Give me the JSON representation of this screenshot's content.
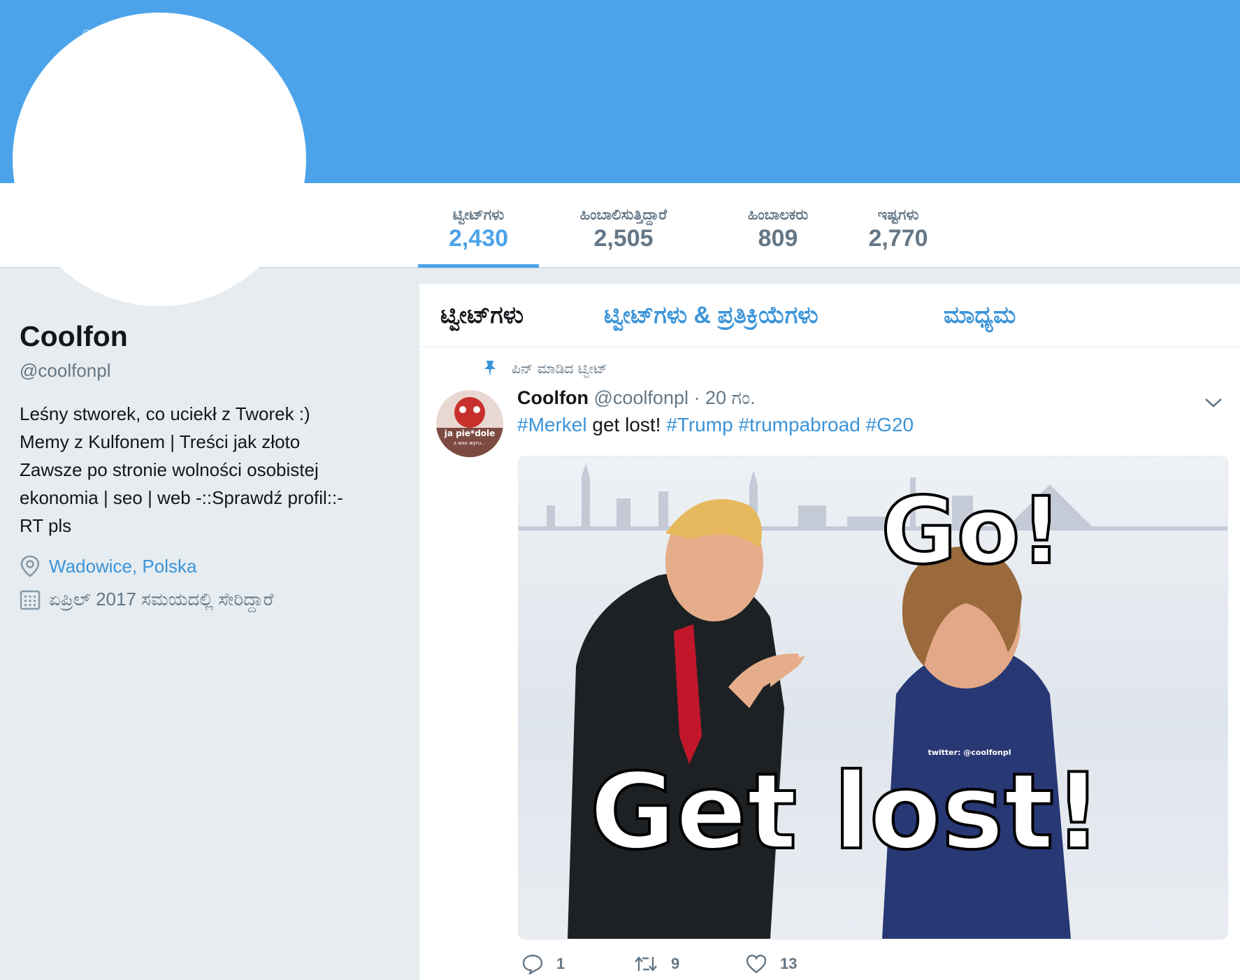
{
  "banner": {
    "partial_text": "on"
  },
  "stats": [
    {
      "label": "ಟ್ವೀಟ್‌ಗಳು",
      "value": "2,430",
      "active": true
    },
    {
      "label": "ಹಿಂಬಾಲಿಸುತ್ತಿದ್ದಾರೆ",
      "value": "2,505",
      "active": false
    },
    {
      "label": "ಹಿಂಬಾಲಕರು",
      "value": "809",
      "active": false
    },
    {
      "label": "ಇಷ್ಟಗಳು",
      "value": "2,770",
      "active": false
    }
  ],
  "profile": {
    "name": "Coolfon",
    "handle": "@coolfonpl",
    "bio_lines": [
      "Leśny stworek, co uciekł z Tworek :)",
      "Memy z Kulfonem | Treści jak złoto",
      "Zawsze po stronie wolności osobistej",
      "ekonomia | seo | web -::Sprawdź profil::-",
      "RT pls"
    ],
    "location": "Wadowice, Polska",
    "joined": "ಏಪ್ರಿಲ್ 2017 ಸಮಯದಲ್ಲಿ ಸೇರಿದ್ದಾರೆ"
  },
  "tabs": [
    {
      "label": "ಟ್ವೀಟ್‌ಗಳು",
      "active": true
    },
    {
      "label": "ಟ್ವೀಟ್‌ಗಳು & ಪ್ರತಿಕ್ರಿಯೆಗಳು",
      "active": false
    },
    {
      "label": "ಮಾಧ್ಯಮ",
      "active": false
    }
  ],
  "tweet": {
    "pinned_label": "ಪಿನ್ ಮಾಡಿದ ಟ್ವೀಟ್",
    "name": "Coolfon",
    "handle": "@coolfonpl",
    "time": "· 20 ಗಂ.",
    "text": {
      "tag1": "#Merkel",
      "plain": " get lost! ",
      "tag2": "#Trump",
      "tag3": "#trumpabroad",
      "tag4": "#G20"
    },
    "avatar_text": {
      "line1": "ja pie*dole",
      "line2": "z was wyru..."
    },
    "media": {
      "caption_top": "Go!",
      "caption_bottom": "Get lost!",
      "watermark": "twitter: @coolfonpl"
    },
    "replies": "1",
    "retweets": "9",
    "likes": "13"
  },
  "colors": {
    "accent": "#4ca3ea",
    "link": "#3b94d9",
    "muted": "#657786",
    "background": "#e6ecf0"
  },
  "icons": [
    "location-pin-icon",
    "calendar-icon",
    "pin-icon",
    "chevron-down-icon",
    "reply-icon",
    "retweet-icon",
    "like-icon"
  ]
}
